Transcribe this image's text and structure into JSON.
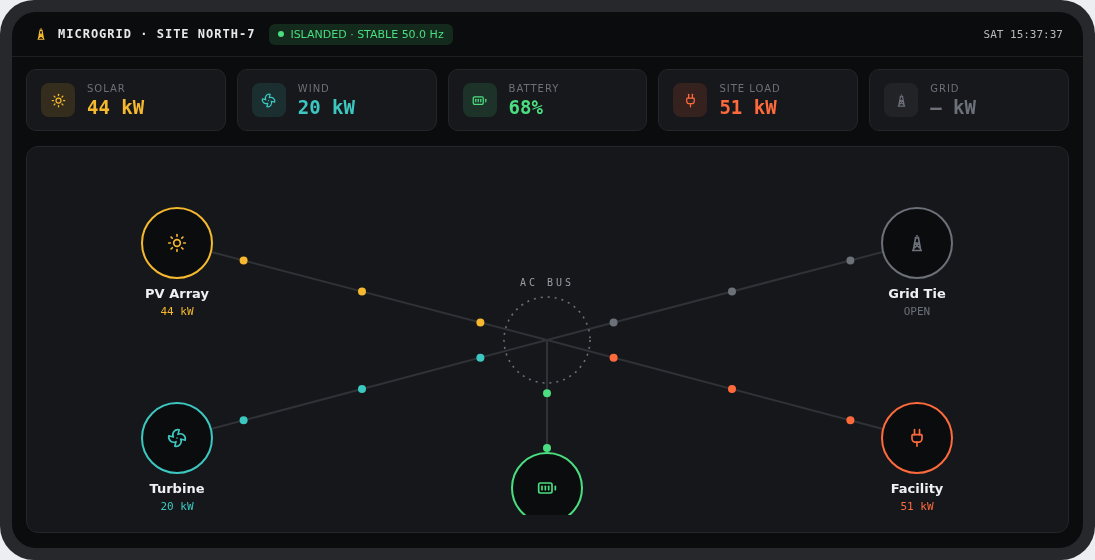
{
  "header": {
    "title": "MICROGRID · SITE NORTH-7",
    "status": "ISLANDED · STABLE 50.0 Hz",
    "clock": "SAT 15:37:37"
  },
  "metrics": [
    {
      "kind": "solar",
      "label": "SOLAR",
      "value": "44 kW",
      "color": "#f5b82e"
    },
    {
      "kind": "wind",
      "label": "WIND",
      "value": "20 kW",
      "color": "#3cc8c0"
    },
    {
      "kind": "battery",
      "label": "BATTERY",
      "value": "68%",
      "color": "#4ade80"
    },
    {
      "kind": "load",
      "label": "SITE LOAD",
      "value": "51 kW",
      "color": "#ff6a3d"
    },
    {
      "kind": "grid",
      "label": "GRID",
      "value": "— kW",
      "color": "#6b7079"
    }
  ],
  "diagram": {
    "bus_label": "AC BUS",
    "nodes": [
      {
        "kind": "solar",
        "name": "PV Array",
        "value": "44 kW",
        "color": "#f5b82e"
      },
      {
        "kind": "wind",
        "name": "Turbine",
        "value": "20 kW",
        "color": "#3cc8c0"
      },
      {
        "kind": "grid",
        "name": "Grid Tie",
        "value": "OPEN",
        "color": "#6b7079"
      },
      {
        "kind": "load",
        "name": "Facility",
        "value": "51 kW",
        "color": "#ff6a3d"
      },
      {
        "kind": "battery",
        "color": "#4ade80"
      }
    ]
  }
}
